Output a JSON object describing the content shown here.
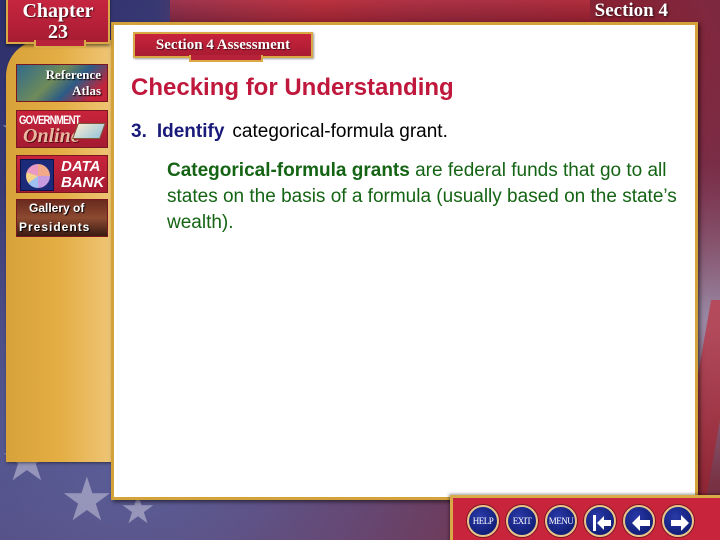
{
  "header": {
    "chapter_label": "Chapter",
    "chapter_number": "23",
    "section_label": "Section 4"
  },
  "sidebar": {
    "items": [
      {
        "name": "reference-atlas",
        "line1": "Reference",
        "line2": "Atlas"
      },
      {
        "name": "government-online",
        "line1": "GOVERNMENT",
        "line2": "Online"
      },
      {
        "name": "data-bank",
        "line1": "DATA",
        "line2": "BANK"
      },
      {
        "name": "gallery-of-presidents",
        "line1": "Gallery of",
        "line2": "Presidents"
      }
    ]
  },
  "main": {
    "banner": "Section 4 Assessment",
    "heading": "Checking for Understanding",
    "question": {
      "number": "3.",
      "verb": "Identify",
      "text": "categorical-formula grant."
    },
    "answer": {
      "term": "Categorical-formula grants",
      "text": " are federal funds that go to all states on the basis of a formula (usually based on the state’s wealth)."
    }
  },
  "nav": {
    "help": "HELP",
    "exit": "EXIT",
    "menu": "MENU",
    "first_icon": "first-slide-icon",
    "prev_icon": "previous-slide-icon",
    "next_icon": "next-slide-icon"
  },
  "colors": {
    "heading": "#c0183c",
    "question_accent": "#1a1a7a",
    "answer": "#146414",
    "badge_red": "#c8243c",
    "gold": "#d9a948",
    "nav_button_blue": "#121f7a"
  }
}
